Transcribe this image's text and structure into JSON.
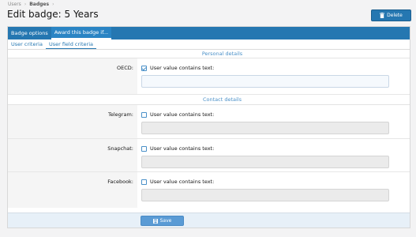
{
  "breadcrumb": [
    "Users",
    "Badges"
  ],
  "page": {
    "title": "Edit badge: 5 Years"
  },
  "actions": {
    "delete_label": "Delete"
  },
  "tabs_primary": [
    {
      "label": "Badge options",
      "active": false
    },
    {
      "label": "Award this badge if...",
      "active": true
    }
  ],
  "tabs_secondary": [
    {
      "label": "User criteria",
      "active": false
    },
    {
      "label": "User field criteria",
      "active": true
    }
  ],
  "sections": {
    "personal": "Personal details",
    "contact": "Contact details"
  },
  "fields": [
    {
      "label": "OECD:",
      "checkbox_label": "User value contains text:",
      "checked": true,
      "value": ""
    },
    {
      "label": "Telegram:",
      "checkbox_label": "User value contains text:",
      "checked": false,
      "value": ""
    },
    {
      "label": "Snapchat:",
      "checkbox_label": "User value contains text:",
      "checked": false,
      "value": ""
    },
    {
      "label": "Facebook:",
      "checkbox_label": "User value contains text:",
      "checked": false,
      "value": ""
    }
  ],
  "footer": {
    "save_label": "Save"
  },
  "colors": {
    "primary": "#2577b1",
    "section_text": "#4a90c8",
    "save_button": "#5a9bd5"
  }
}
